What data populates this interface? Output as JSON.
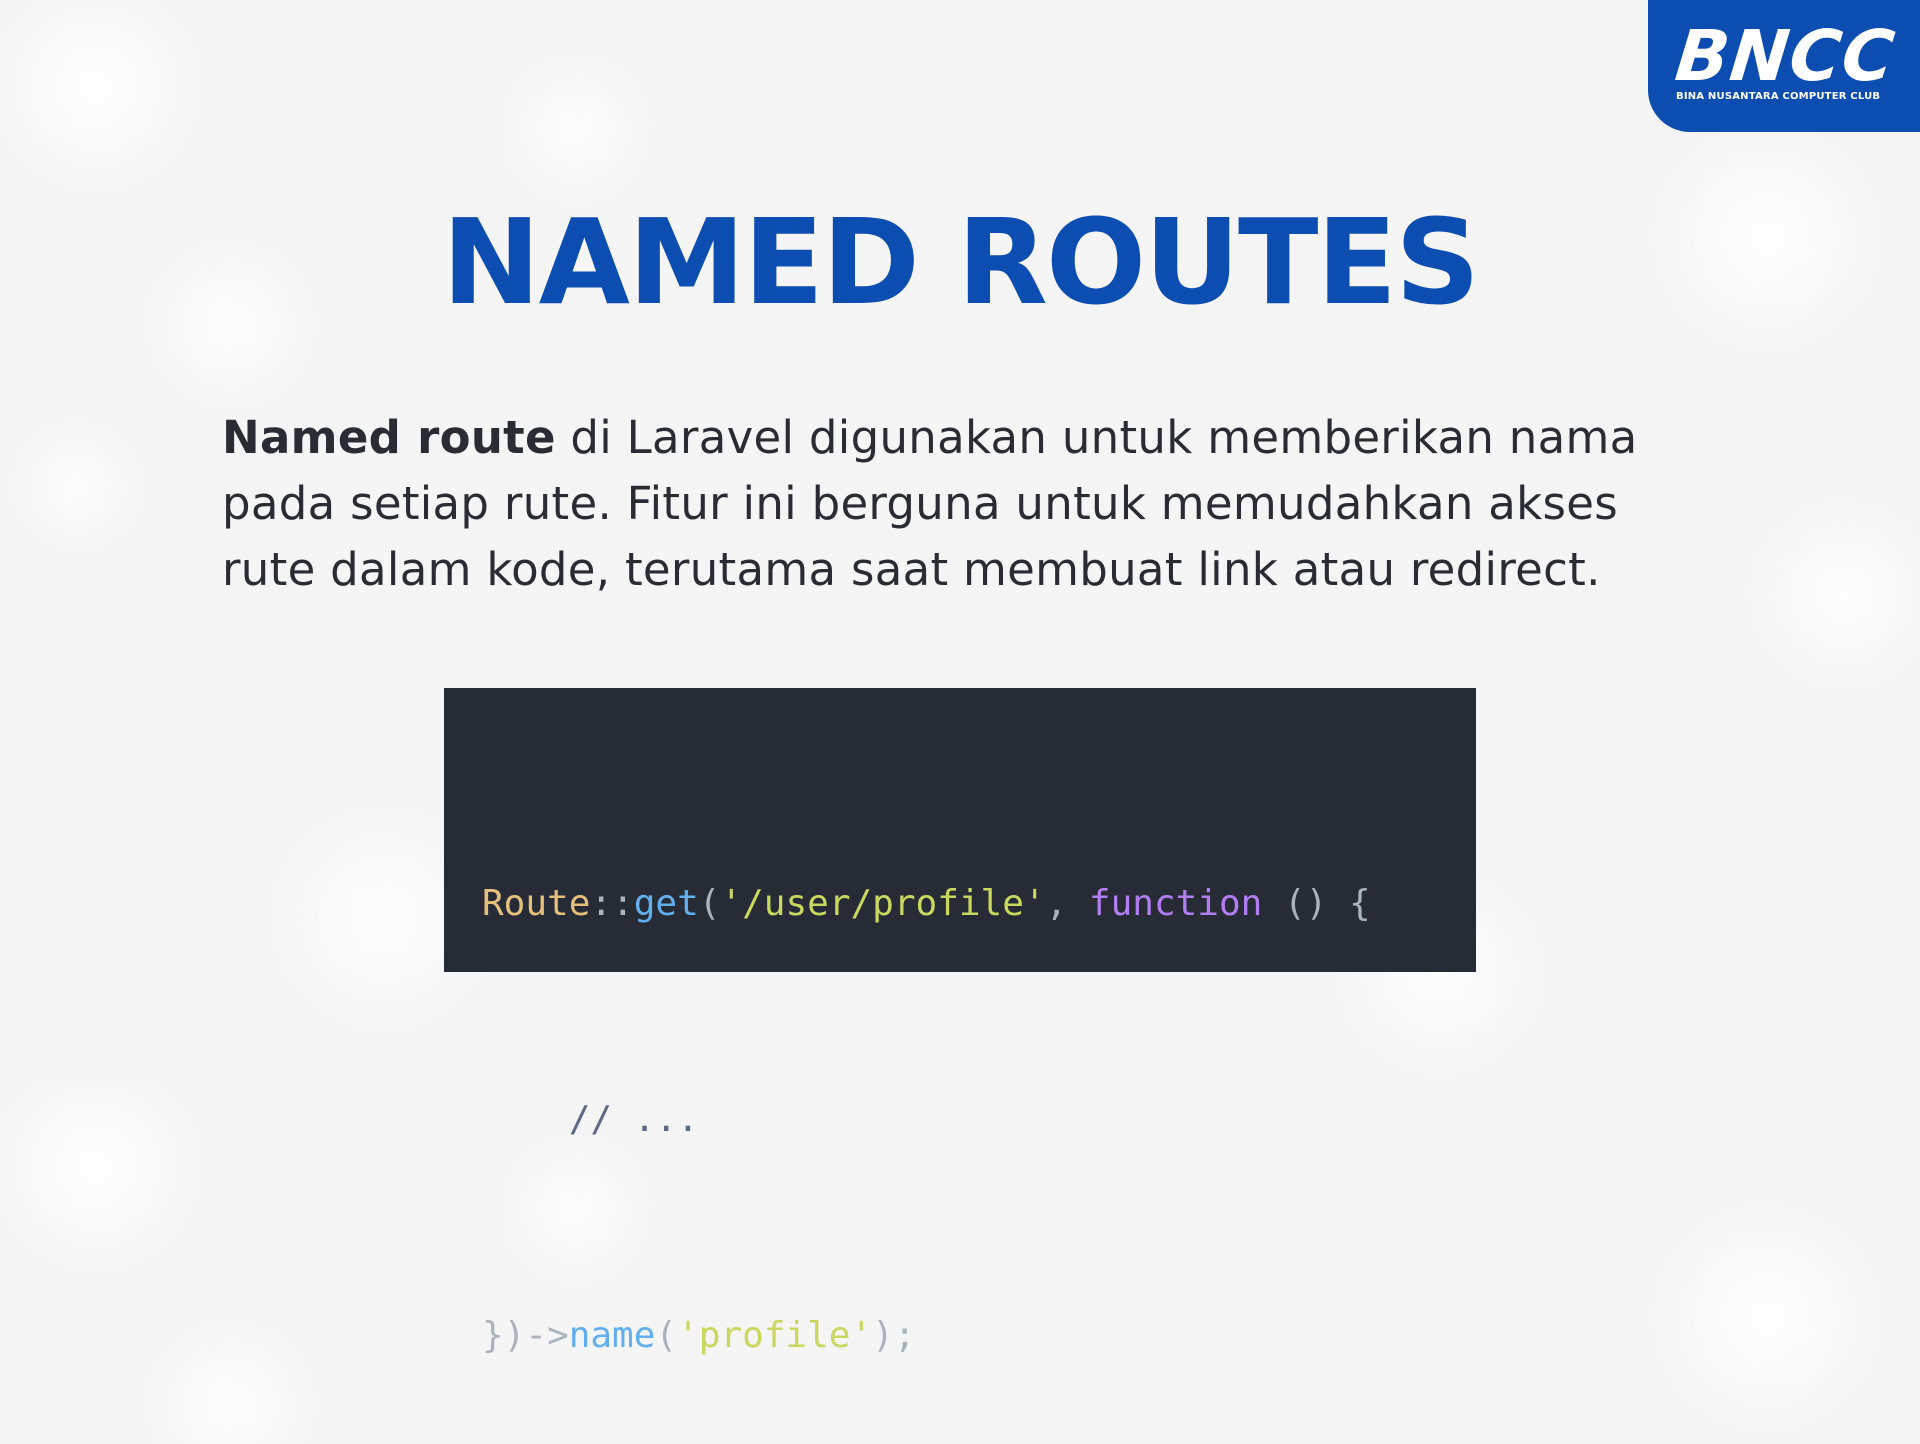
{
  "logo": {
    "wordmark": "BNCC",
    "tagline": "BINA NUSANTARA COMPUTER CLUB"
  },
  "slide": {
    "title": "NAMED ROUTES",
    "description": {
      "term": "Named route",
      "text": " di Laravel digunakan untuk memberikan nama pada setiap rute. Fitur ini berguna untuk memudahkan akses rute dalam kode, terutama saat membuat link atau redirect."
    }
  },
  "code": {
    "line1": {
      "class": "Route",
      "sep": "::",
      "method": "get",
      "open": "(",
      "path": "'/user/profile'",
      "comma": ", ",
      "keyword": "function",
      "rest": " () {"
    },
    "line2": {
      "comment": "    // ..."
    },
    "line3": {
      "close": "})->",
      "method": "name",
      "open": "(",
      "name_arg": "'profile'",
      "end": ");"
    }
  },
  "colors": {
    "brand": "#0c4db2",
    "code_background": "#272b36"
  }
}
